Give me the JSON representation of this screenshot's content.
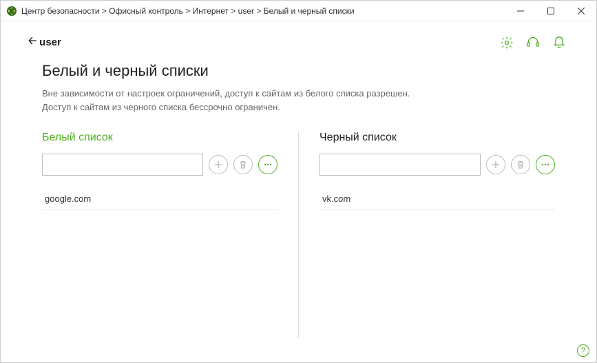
{
  "breadcrumb": "Центр безопасности > Офисный контроль > Интернет > user > Белый и черный списки",
  "back_label": "user",
  "page_title": "Белый и черный списки",
  "description_line1": "Вне зависимости от настроек ограничений, доступ к сайтам из белого списка разрешен.",
  "description_line2": "Доступ к сайтам из черного списка бессрочно ограничен.",
  "whitelist": {
    "title": "Белый список",
    "input_value": "",
    "items": [
      "google.com"
    ]
  },
  "blacklist": {
    "title": "Черный список",
    "input_value": "",
    "items": [
      "vk.com"
    ]
  },
  "help_label": "?"
}
